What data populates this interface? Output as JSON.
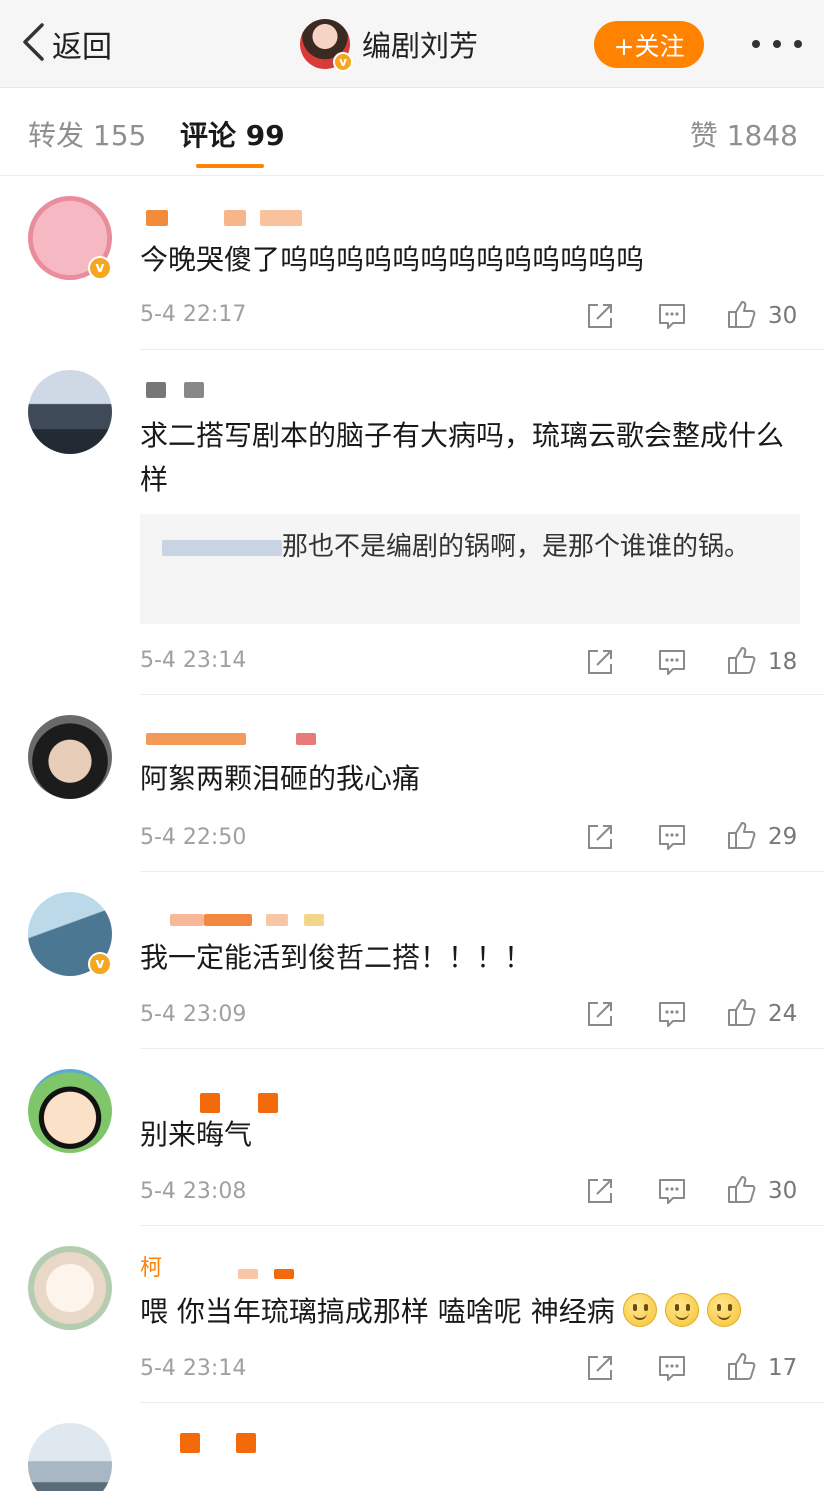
{
  "nav": {
    "back_label": "返回",
    "user_name": "编剧刘芳",
    "verified_mark": "v",
    "follow_label": "+关注"
  },
  "tabs": {
    "repost": "转发 155",
    "comment": "评论 99",
    "like": "赞 1848"
  },
  "colors": {
    "accent": "#ff8200",
    "verified": "#f5a623",
    "reply_user": "#5b7ba5"
  },
  "comments": [
    {
      "user_prefix": "",
      "text": "今晚哭傻了呜呜呜呜呜呜呜呜呜呜呜呜呜",
      "time": "5-4 22:17",
      "likes": "30"
    },
    {
      "user_prefix": "",
      "text": "求二搭写剧本的脑子有大病吗，琉璃云歌会整成什么样",
      "reply_user": "",
      "reply_text": "那也不是编剧的锅啊，是那个谁谁的锅。",
      "time": "5-4 23:14",
      "likes": "18"
    },
    {
      "user_prefix": "",
      "text": "阿絮两颗泪砸的我心痛",
      "time": "5-4 22:50",
      "likes": "29"
    },
    {
      "user_prefix": "",
      "text": "我一定能活到俊哲二搭！！！！",
      "time": "5-4 23:09",
      "likes": "24"
    },
    {
      "user_prefix": "",
      "text": "别来晦气",
      "time": "5-4 23:08",
      "likes": "30"
    },
    {
      "user_prefix": "柯",
      "text": "喂 你当年琉璃搞成那样 嗑啥呢 神经病",
      "time": "5-4 23:14",
      "likes": "17"
    },
    {
      "user_prefix": "",
      "text": "",
      "time": "",
      "likes": ""
    }
  ]
}
